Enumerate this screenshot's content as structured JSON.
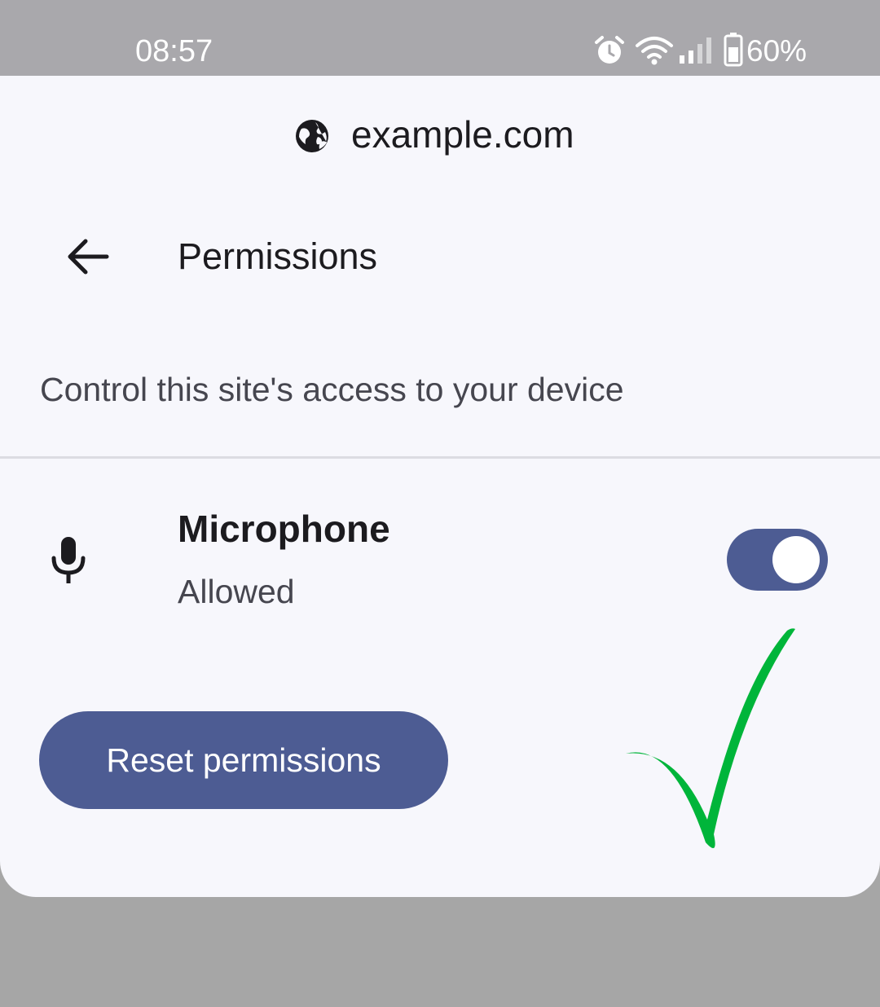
{
  "status_bar": {
    "time": "08:57",
    "battery": "60%",
    "icons": [
      "alarm-icon",
      "wifi-icon",
      "signal-icon",
      "battery-icon"
    ]
  },
  "site": {
    "icon": "globe-icon",
    "name": "example.com"
  },
  "header": {
    "back_icon": "arrow-back-icon",
    "title": "Permissions"
  },
  "description": "Control this site's access to your device",
  "permissions": [
    {
      "icon": "microphone-icon",
      "name": "Microphone",
      "status": "Allowed",
      "enabled": true
    }
  ],
  "reset_button": {
    "label": "Reset permissions"
  },
  "annotation": {
    "type": "checkmark",
    "color": "#00b53a"
  },
  "colors": {
    "accent": "#4d5c93",
    "sheet_background": "#f7f7fc",
    "status_bar": "#a9a8ac",
    "scrim": "#a6a6a6"
  }
}
